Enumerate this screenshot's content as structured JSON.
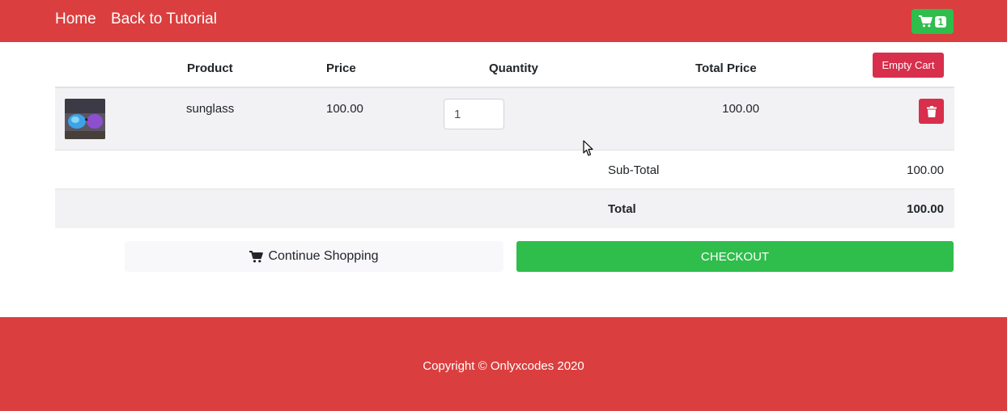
{
  "nav": {
    "home": "Home",
    "back": "Back to Tutorial",
    "cart_count": "1",
    "cart_icon": "shopping-cart-icon"
  },
  "table": {
    "headers": {
      "product": "Product",
      "price": "Price",
      "quantity": "Quantity",
      "total_price": "Total Price"
    },
    "empty_cart_label": "Empty Cart",
    "items": [
      {
        "name": "sunglass",
        "price": "100.00",
        "quantity": "1",
        "total": "100.00",
        "image_icon": "sunglass-product-image",
        "delete_icon": "trash-icon"
      }
    ],
    "subtotal_label": "Sub-Total",
    "subtotal_value": "100.00",
    "total_label": "Total",
    "total_value": "100.00"
  },
  "actions": {
    "continue_label": "Continue Shopping",
    "checkout_label": "CHECKOUT"
  },
  "footer": {
    "copyright": "Copyright © Onlyxcodes 2020"
  },
  "colors": {
    "brand_red": "#db3e3e",
    "success_green": "#2fbd4c",
    "danger": "#d72f4c"
  }
}
